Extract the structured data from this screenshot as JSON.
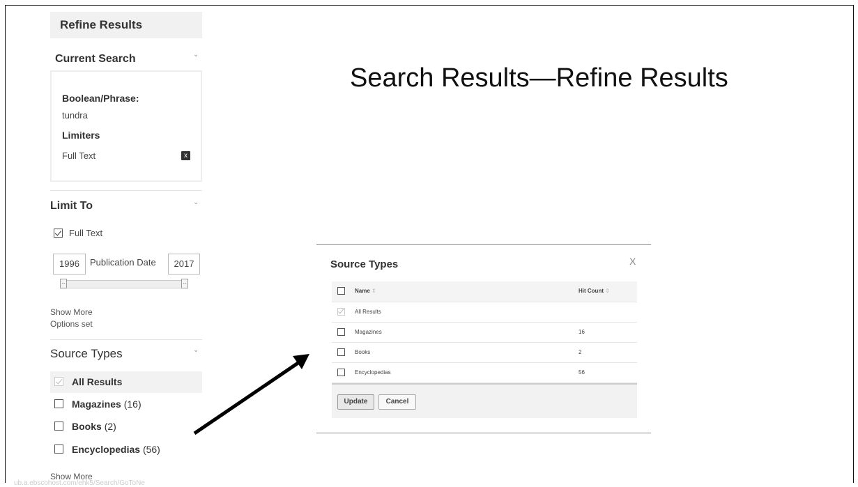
{
  "slide_title": "Search Results—Refine Results",
  "sidebar": {
    "header": "Refine Results",
    "current_search": {
      "title": "Current Search",
      "boolean_label": "Boolean/Phrase:",
      "boolean_value": "tundra",
      "limiters_label": "Limiters",
      "limiter_value": "Full Text",
      "remove_icon": "x"
    },
    "limit_to": {
      "title": "Limit To",
      "full_text_label": "Full Text",
      "date_from": "1996",
      "date_label": "Publication Date",
      "date_to": "2017",
      "show_more": "Show More",
      "options_set": "Options set"
    },
    "source_types": {
      "title": "Source Types",
      "items": [
        {
          "label": "All Results",
          "count": "",
          "checked": true
        },
        {
          "label": "Magazines",
          "count": "(16)",
          "checked": false
        },
        {
          "label": "Books",
          "count": "(2)",
          "checked": false
        },
        {
          "label": "Encyclopedias",
          "count": "(56)",
          "checked": false
        }
      ],
      "show_more": "Show More"
    },
    "url_ghost": "ub.a.ebscohost.com/ehk5/Search/GoToNe"
  },
  "modal": {
    "title": "Source Types",
    "close": "X",
    "columns": {
      "name": "Name",
      "count": "Hit Count",
      "sort_icon": "⇕"
    },
    "rows": [
      {
        "name": "All Results",
        "count": "",
        "checked": true
      },
      {
        "name": "Magazines",
        "count": "16",
        "checked": false
      },
      {
        "name": "Books",
        "count": "2",
        "checked": false
      },
      {
        "name": "Encyclopedias",
        "count": "56",
        "checked": false
      }
    ],
    "update_label": "Update",
    "cancel_label": "Cancel"
  },
  "colors": {
    "arrow": "#000000",
    "panel_bg": "#f1f1f1"
  }
}
